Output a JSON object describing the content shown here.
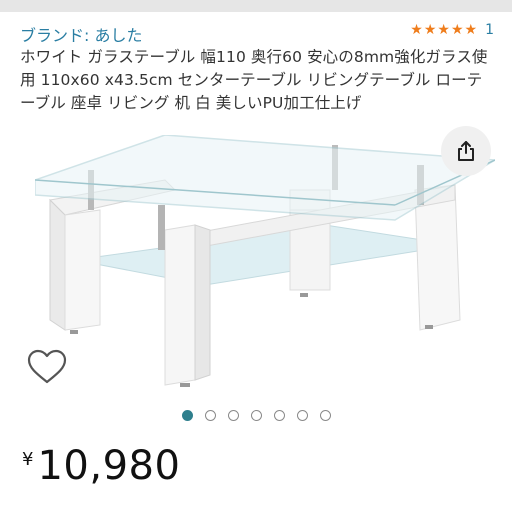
{
  "brand_label": "ブランド: あした",
  "rating": {
    "stars": 5,
    "count": "1",
    "color": "#ef7d1c"
  },
  "product": {
    "title": "ホワイト ガラステーブル 幅110 奥行60 安心の8mm強化ガラス使用 110x60 x43.5cm センターテーブル リビングテーブル ローテーブル 座卓 リビング 机 白 美しいPU加工仕上げ"
  },
  "icons": {
    "share": "share-icon",
    "wishlist": "heart-icon",
    "star": "star-icon"
  },
  "carousel": {
    "total": 7,
    "active_index": 0
  },
  "price": {
    "currency": "¥",
    "value": "10,980"
  },
  "colors": {
    "link": "#2a7ea3",
    "dot_active": "#2f7f8d"
  }
}
